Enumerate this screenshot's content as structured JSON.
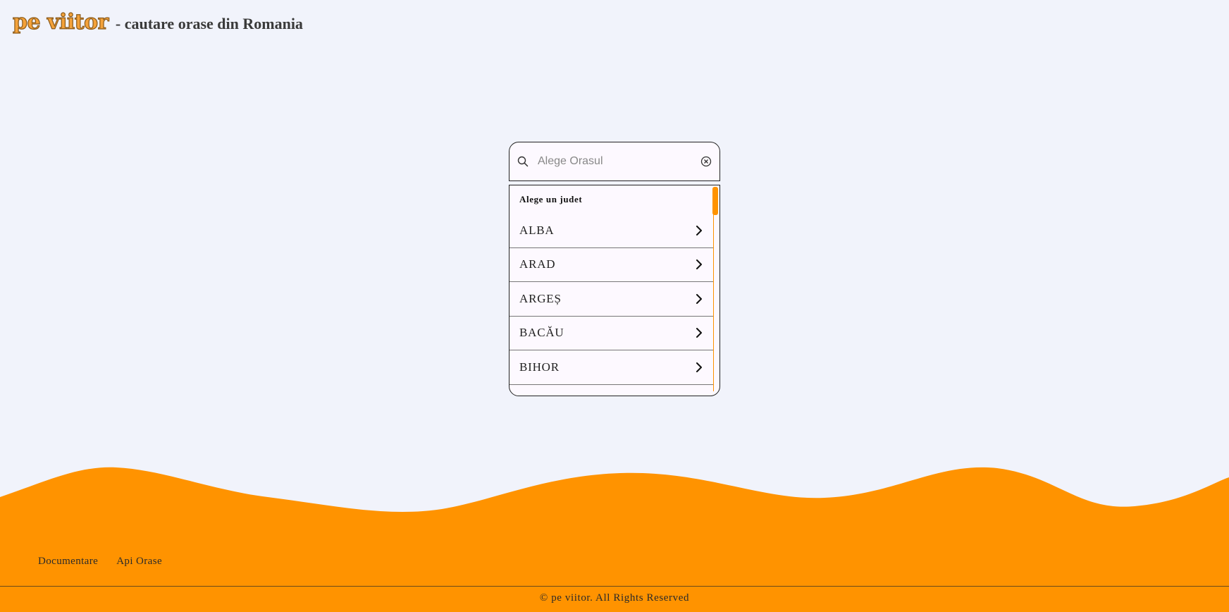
{
  "header": {
    "logo": "pe viitor",
    "tagline": "- cautare orase din Romania"
  },
  "search": {
    "placeholder": "Alege Orasul",
    "value": ""
  },
  "dropdown": {
    "heading": "Alege un judet",
    "counties": [
      "ALBA",
      "ARAD",
      "ARGEȘ",
      "BACĂU",
      "BIHOR"
    ]
  },
  "footer": {
    "links": [
      "Documentare",
      "Api Orase"
    ],
    "copyright": "© pe viitor. All Rights Reserved"
  },
  "colors": {
    "accent": "#ff9300",
    "background": "#f1f3fb",
    "logo": "#f4a23a"
  },
  "icons": {
    "search": "search-icon",
    "clear": "clear-icon",
    "chevron": "chevron-right-icon"
  }
}
